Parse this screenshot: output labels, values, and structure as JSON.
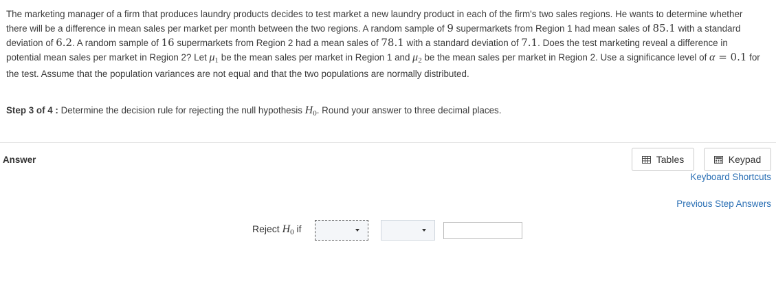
{
  "problem": {
    "p1": "The marketing manager of a firm that produces laundry products decides to test market a new laundry product in each of the firm's two sales regions.  He wants to determine whether there will be a difference in mean sales per market per month between the two regions.  A random sample of ",
    "n1": "9",
    "p2": " supermarkets from Region 1 had mean sales of ",
    "m1": "85.1",
    "p3": " with a standard deviation of ",
    "s1": "6.2",
    "p4": ".  A random sample of ",
    "n2": "16",
    "p5": " supermarkets from Region 2 had a mean sales of ",
    "m2": "78.1",
    "p6": " with a standard deviation of ",
    "s2": "7.1",
    "p7": ".  Does the test marketing reveal a difference in potential mean sales per market in Region 2?  Let ",
    "mu": "μ",
    "sub1": "1",
    "p8": " be the mean sales per market in Region 1 and ",
    "sub2": "2",
    "p9": " be the mean sales per market in Region 2.  Use a significance level of ",
    "alpha": "α",
    "eq": " = ",
    "alpha_val": "0.1",
    "p10": " for the test.  Assume that the population variances are not equal and that the two populations are normally distributed."
  },
  "step": {
    "label": "Step 3 of 4 :",
    "text": " Determine the decision rule for rejecting the null hypothesis ",
    "h": "H",
    "h_sub": "0",
    "text2": ". Round your answer to three decimal places."
  },
  "answer": {
    "label": "Answer",
    "reject_text": "Reject ",
    "reject_h": "H",
    "reject_h_sub": "0",
    "reject_if": " if",
    "input_value": ""
  },
  "tools": {
    "tables_label": "Tables",
    "keypad_label": "Keypad",
    "shortcuts_link": "Keyboard Shortcuts",
    "previous_link": "Previous Step Answers"
  },
  "colors": {
    "link": "#2a6fb4",
    "text": "#3a3a3a"
  }
}
